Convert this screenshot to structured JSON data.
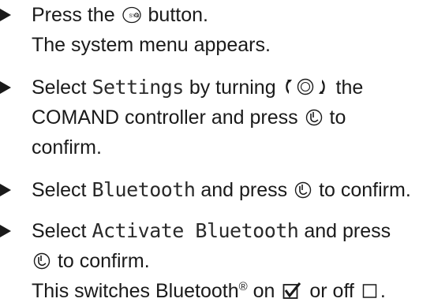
{
  "steps": [
    {
      "lines": [
        {
          "before": "Press the",
          "icon": "sys-button-icon",
          "after": "button."
        },
        {
          "text": "The system menu appears."
        }
      ]
    },
    {
      "lines": [
        {
          "before": "Select",
          "menu": "Settings",
          "middle": "by turning",
          "icon": "turn-controller-icon",
          "after": "the"
        },
        {
          "before": "COMAND controller and press",
          "icon": "press-controller-icon",
          "after": "to"
        },
        {
          "text": "confirm."
        }
      ]
    },
    {
      "lines": [
        {
          "before": "Select",
          "menu": "Bluetooth",
          "middle": "and press",
          "icon": "press-controller-icon",
          "after": "to confirm."
        }
      ]
    },
    {
      "lines": [
        {
          "before": "Select",
          "menu": "Activate Bluetooth",
          "after": "and press"
        },
        {
          "icon": "press-controller-icon",
          "after": "to confirm."
        },
        {
          "before": "This switches Bluetooth",
          "sup": "®",
          "middle": "on",
          "icon": "checked-box-icon",
          "middle2": "or off",
          "icon2": "empty-box-icon",
          "after": "."
        }
      ]
    }
  ]
}
